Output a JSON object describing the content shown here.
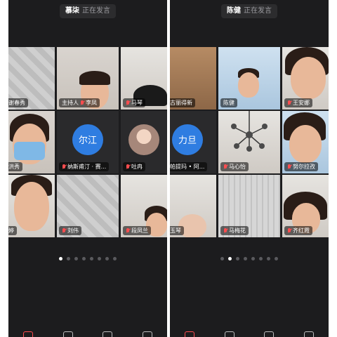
{
  "colors": {
    "background": "#1c1c1e",
    "active_border": "#2ecc40",
    "avatar_blue": "#2f7de1",
    "muted_mic": "#ff4d4f"
  },
  "left_screen": {
    "speaker": {
      "name": "慕柒",
      "status": "正在发言"
    },
    "tiles": [
      {
        "label": "谢春秀",
        "muted": false
      },
      {
        "label": "主持人",
        "muted": false
      },
      {
        "label": "李凤",
        "muted": true
      },
      {
        "label": "马琴",
        "muted": true
      },
      {
        "label": "洪秀",
        "muted": false
      },
      {
        "avatar": "尔江",
        "label": "纳斯甫汀 · 赛...",
        "muted": true
      },
      {
        "label": "吐冉",
        "muted": true
      },
      {
        "label": "婷",
        "muted": false
      },
      {
        "label": "刘伟",
        "muted": true
      },
      {
        "label": "段凤兰",
        "muted": true
      }
    ],
    "page_dots": {
      "total": 8,
      "active": 1
    }
  },
  "right_screen": {
    "speaker": {
      "name": "陈健",
      "status": "正在发言"
    },
    "tiles": [
      {
        "label": "古丽得新",
        "muted": false
      },
      {
        "label": "陈健",
        "muted": false
      },
      {
        "label": "王安娜",
        "muted": true
      },
      {
        "avatar": "力旦",
        "label": "帕提玛 • 阿...",
        "muted": false
      },
      {
        "label": "马心怡",
        "muted": true
      },
      {
        "label": "努尔拉孜",
        "muted": true
      },
      {
        "label": "玉琴",
        "muted": false
      },
      {
        "label": "马梅花",
        "muted": true
      },
      {
        "label": "齐红霞",
        "muted": true
      }
    ],
    "page_dots": {
      "total": 8,
      "active": 2
    }
  },
  "toolbar_icons": [
    "mic-off-icon",
    "video-icon",
    "share-icon",
    "people-icon",
    "more-icon"
  ]
}
